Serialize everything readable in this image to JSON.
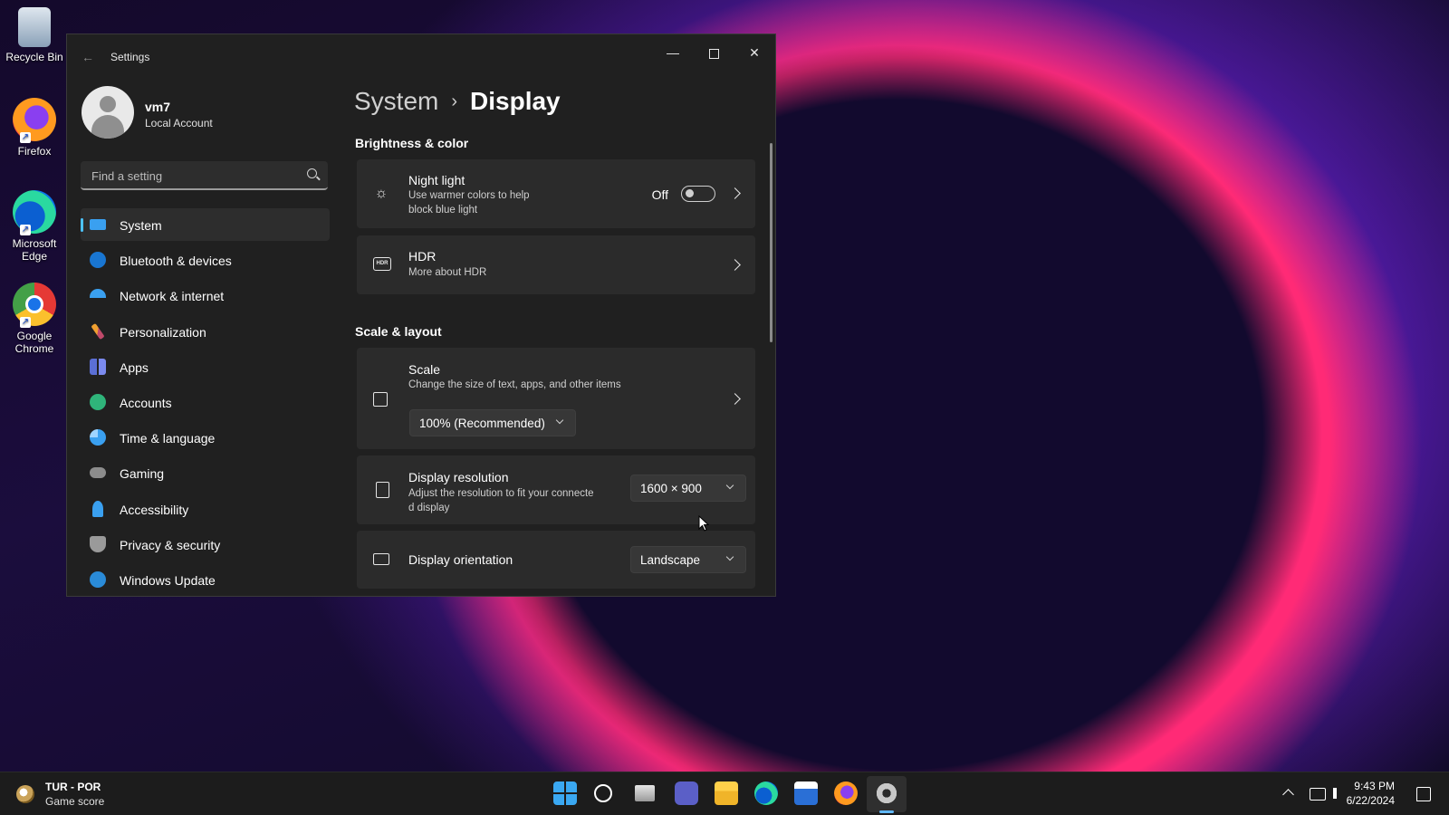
{
  "desktop": {
    "icons": [
      {
        "label": "Recycle Bin"
      },
      {
        "label": "Firefox"
      },
      {
        "label_line1": "Microsoft",
        "label_line2": "Edge"
      },
      {
        "label_line1": "Google",
        "label_line2": "Chrome"
      }
    ]
  },
  "window": {
    "title": "Settings",
    "controls": {
      "minimize": "—",
      "close": "✕"
    }
  },
  "profile": {
    "name": "vm7",
    "type": "Local Account"
  },
  "search": {
    "placeholder": "Find a setting"
  },
  "sidebar": {
    "items": [
      {
        "label": "System",
        "icon": "display-icon",
        "active": true
      },
      {
        "label": "Bluetooth & devices",
        "icon": "bluetooth-icon"
      },
      {
        "label": "Network & internet",
        "icon": "wifi-icon"
      },
      {
        "label": "Personalization",
        "icon": "brush-icon"
      },
      {
        "label": "Apps",
        "icon": "apps-icon"
      },
      {
        "label": "Accounts",
        "icon": "person-icon"
      },
      {
        "label": "Time & language",
        "icon": "clock-globe-icon"
      },
      {
        "label": "Gaming",
        "icon": "controller-icon"
      },
      {
        "label": "Accessibility",
        "icon": "accessibility-icon"
      },
      {
        "label": "Privacy & security",
        "icon": "shield-icon"
      },
      {
        "label": "Windows Update",
        "icon": "update-icon"
      }
    ]
  },
  "breadcrumb": {
    "parent": "System",
    "separator": "›",
    "current": "Display"
  },
  "brightness_section": {
    "title": "Brightness & color",
    "night_light": {
      "title": "Night light",
      "subtitle_line1": "Use warmer colors to help",
      "subtitle_line2": "block blue light",
      "state_label": "Off",
      "enabled": false
    },
    "hdr": {
      "title": "HDR",
      "subtitle": "More about HDR",
      "badge": "HDR"
    }
  },
  "scale_section": {
    "title": "Scale & layout",
    "scale": {
      "title": "Scale",
      "subtitle": "Change the size of text, apps, and other items",
      "value": "100% (Recommended)"
    },
    "resolution": {
      "title": "Display resolution",
      "subtitle_line1": "Adjust the resolution to fit your connecte",
      "subtitle_line2": "d display",
      "value": "1600 × 900"
    },
    "orientation": {
      "title": "Display orientation",
      "value": "Landscape"
    }
  },
  "taskbar": {
    "widget": {
      "title": "TUR - POR",
      "subtitle": "Game score"
    },
    "apps": [
      "start-icon",
      "search-icon",
      "task-view-icon",
      "chat-icon",
      "file-explorer-icon",
      "edge-icon",
      "store-icon",
      "firefox-icon",
      "settings-icon"
    ],
    "clock": {
      "time": "9:43 PM",
      "date": "6/22/2024"
    }
  },
  "colors": {
    "accent": "#4cc2ff",
    "window_bg": "#202020",
    "card_bg": "#2b2b2b",
    "taskbar_bg": "#1c1c1c"
  }
}
